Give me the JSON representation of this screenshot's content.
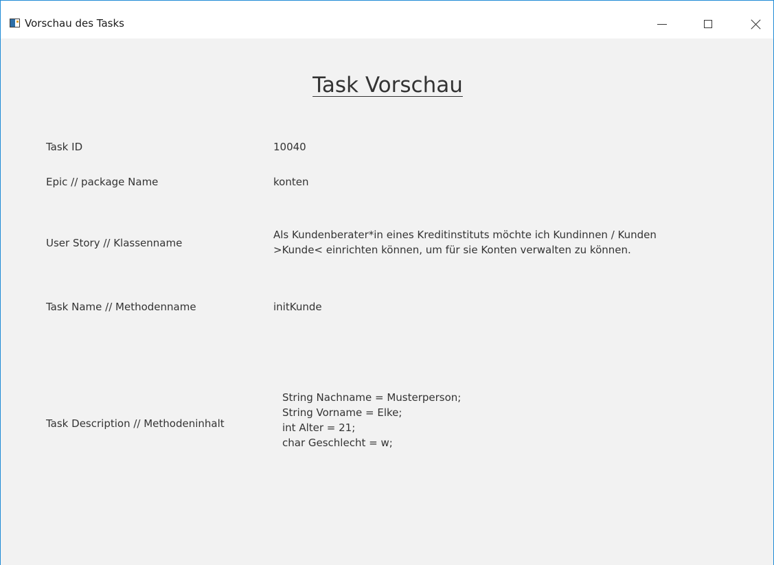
{
  "window": {
    "title": "Vorschau des Tasks",
    "icon": "app-window-icon",
    "controls": [
      "minimize-icon",
      "maximize-icon",
      "close-icon"
    ]
  },
  "page": {
    "heading": "Task Vorschau"
  },
  "fields": {
    "task_id": {
      "label": "Task ID",
      "value": "10040"
    },
    "epic": {
      "label": "Epic // package Name",
      "value": "konten"
    },
    "user_story": {
      "label": "User Story // Klassenname",
      "value": "Als Kundenberater*in eines Kreditinstituts möchte ich Kundinnen / Kunden\n>Kunde< einrichten können, um für sie Konten verwalten zu können."
    },
    "task_name": {
      "label": "Task Name // Methodenname",
      "value": "initKunde"
    },
    "task_description": {
      "label": "Task Description // Methodeninhalt",
      "value": "String Nachname = Musterperson;\nString Vorname = Elke;\nint Alter = 21;\nchar Geschlecht = w;"
    }
  },
  "colors": {
    "window_border": "#1e8ad6",
    "content_background": "#f2f2f2",
    "text": "#333333"
  }
}
